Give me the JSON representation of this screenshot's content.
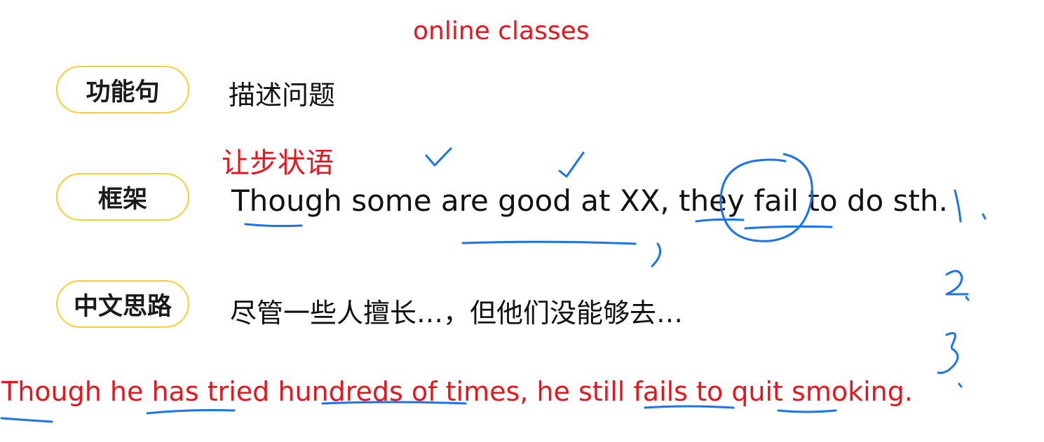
{
  "title": "online classes",
  "rows": [
    {
      "tag": "功能句",
      "text": "描述问题"
    },
    {
      "tag": "框架",
      "text": "Though some are good at XX, they fail to do sth."
    },
    {
      "tag": "中文思路",
      "text": "尽管一些人擅长…，但他们没能够去…"
    }
  ],
  "annotation_label": "让步状语",
  "example_sentence": "Though he has tried hundreds of times, he still fails to quit smoking.",
  "colors": {
    "title_red": "#e8141e",
    "pill_border": "#f5cf36",
    "ink_blue": "#1a73e8"
  }
}
